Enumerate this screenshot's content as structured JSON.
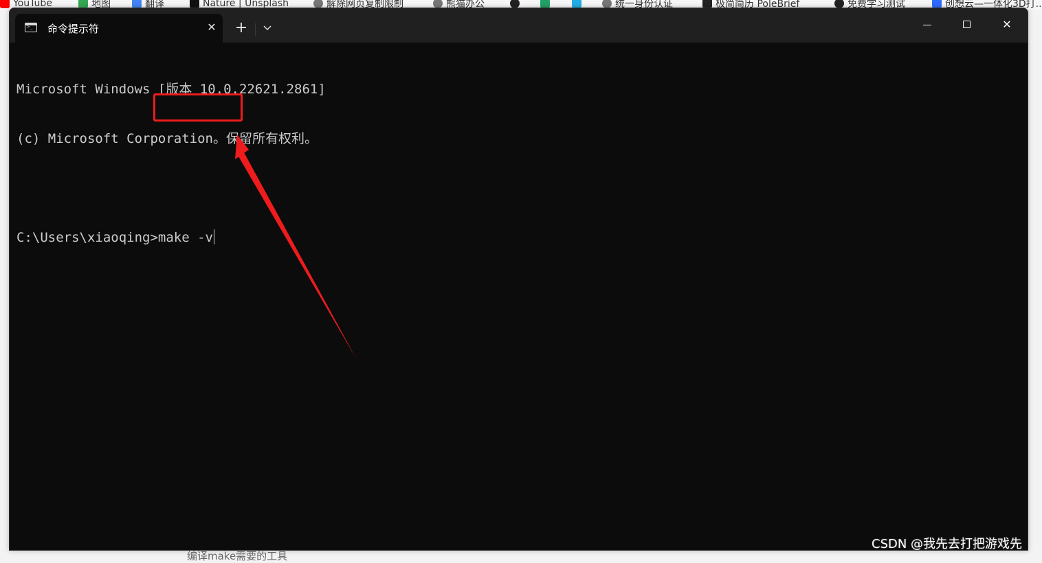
{
  "bookmarks": [
    {
      "label": "YouTube",
      "icon": "youtube-icon",
      "color": "#ff0000"
    },
    {
      "label": "地图",
      "icon": "map-icon",
      "color": "#34a853"
    },
    {
      "label": "翻译",
      "icon": "translate-icon",
      "color": "#4285f4"
    },
    {
      "label": "Nature | Unsplash",
      "icon": "unsplash-icon",
      "color": "#111111"
    },
    {
      "label": "解除网页复制限制",
      "icon": "globe-icon",
      "color": "#555555"
    },
    {
      "label": "熊猫办公",
      "icon": "globe-icon",
      "color": "#555555"
    },
    {
      "label": "",
      "icon": "github-icon",
      "color": "#222222"
    },
    {
      "label": "",
      "icon": "jetbrains-icon",
      "color": "#21a366"
    },
    {
      "label": "",
      "icon": "bilibili-icon",
      "color": "#23ade5"
    },
    {
      "label": "统一身份认证",
      "icon": "globe-icon",
      "color": "#555555"
    },
    {
      "label": "极简简历 PoleBrief",
      "icon": "polebrief-icon",
      "color": "#222222"
    },
    {
      "label": "免费学习测试",
      "icon": "openai-icon",
      "color": "#222222"
    },
    {
      "label": "创想云—一体化3D打...",
      "icon": "chuangxiang-icon",
      "color": "#2f6bff"
    }
  ],
  "window": {
    "tab_title": "命令提示符",
    "new_tab_label": "+",
    "dropdown_label": "⌄",
    "close_tab_label": "✕",
    "close_window_label": "✕"
  },
  "console": {
    "lines": [
      "Microsoft Windows [版本 10.0.22621.2861]",
      "(c) Microsoft Corporation。保留所有权利。",
      "",
      "C:\\Users\\xiaoqing>make -v"
    ]
  },
  "annotation": {
    "highlight_color": "#ee1c1c"
  },
  "below_text": "编译make需要的工具",
  "watermark": "CSDN @我先去打把游戏先"
}
